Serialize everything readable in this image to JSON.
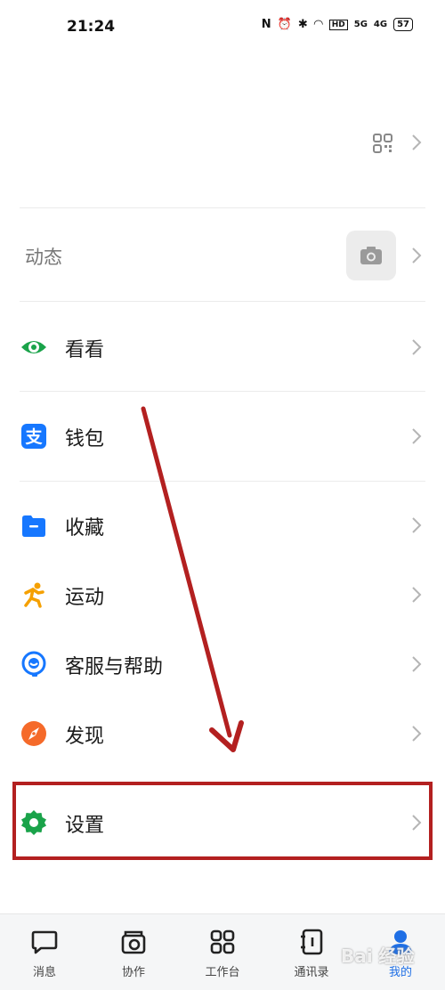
{
  "status_bar": {
    "time": "21:24",
    "nfc": "N",
    "hd": "HD",
    "sig1": "5G",
    "sig2": "4G",
    "battery": "57"
  },
  "moments": {
    "label": "动态"
  },
  "menu": [
    {
      "key": "kankan",
      "label": "看看",
      "icon": "eye-icon",
      "color": "#1aa34a"
    },
    {
      "key": "wallet",
      "label": "钱包",
      "icon": "alipay-icon",
      "color": "#1677ff"
    },
    {
      "key": "favorites",
      "label": "收藏",
      "icon": "folder-icon",
      "color": "#1677ff"
    },
    {
      "key": "sport",
      "label": "运动",
      "icon": "runner-icon",
      "color": "#f5a000"
    },
    {
      "key": "service",
      "label": "客服与帮助",
      "icon": "headset-icon",
      "color": "#1677ff"
    },
    {
      "key": "discover",
      "label": "发现",
      "icon": "compass-icon",
      "color": "#f56a2a"
    },
    {
      "key": "settings",
      "label": "设置",
      "icon": "gear-icon",
      "color": "#1aa34a"
    }
  ],
  "tabs": [
    {
      "label": "消息",
      "icon": "message-icon"
    },
    {
      "label": "协作",
      "icon": "collab-icon"
    },
    {
      "label": "工作台",
      "icon": "grid-icon"
    },
    {
      "label": "通讯录",
      "icon": "contacts-icon"
    },
    {
      "label": "我的",
      "icon": "profile-icon",
      "active": true
    }
  ],
  "annotation_color": "#b32020",
  "watermark": "Bai 经验"
}
